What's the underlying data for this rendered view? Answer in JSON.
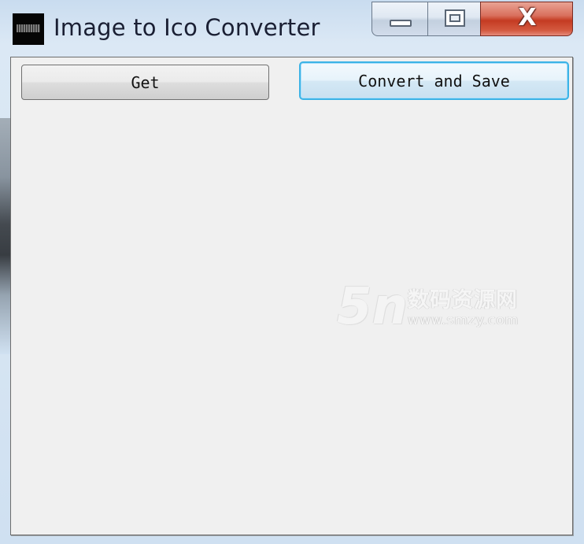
{
  "window": {
    "title": "Image to Ico Converter",
    "app_icon": "app-logo-icon",
    "controls": {
      "minimize": "minimize-icon",
      "maximize": "maximize-icon",
      "close_glyph": "X"
    }
  },
  "toolbar": {
    "get_label": "Get",
    "convert_label": "Convert and Save"
  },
  "watermark": {
    "logo": "5n",
    "site_name": "数码资源网",
    "url": "www.smzy.com"
  },
  "colors": {
    "focus_border": "#3cb3e6",
    "close_red": "#c43b22",
    "client_bg": "#f0f0f0"
  }
}
